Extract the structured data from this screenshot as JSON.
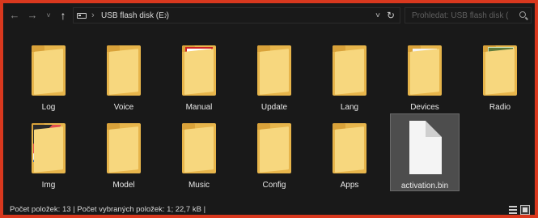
{
  "address_bar": {
    "back_icon": "arrow-left-icon",
    "forward_icon": "arrow-right-icon",
    "recent_icon": "chevron-down-icon",
    "up_icon": "arrow-up-icon",
    "path": "USB flash disk (E:)",
    "search_placeholder": "Prohledat: USB flash disk (E:)"
  },
  "items": [
    {
      "label": "Log",
      "kind": "folder",
      "doc": "blue"
    },
    {
      "label": "Voice",
      "kind": "folder",
      "doc": "blue"
    },
    {
      "label": "Manual",
      "kind": "folder",
      "doc": "red"
    },
    {
      "label": "Update",
      "kind": "folder",
      "doc": "none"
    },
    {
      "label": "Lang",
      "kind": "folder",
      "doc": "blue"
    },
    {
      "label": "Devices",
      "kind": "folder",
      "doc": "wide"
    },
    {
      "label": "Radio",
      "kind": "folder",
      "doc": "green"
    },
    {
      "label": "Img",
      "kind": "folder",
      "doc": "photo"
    },
    {
      "label": "Model",
      "kind": "folder",
      "doc": "none"
    },
    {
      "label": "Music",
      "kind": "folder",
      "doc": "none"
    },
    {
      "label": "Config",
      "kind": "folder",
      "doc": "none"
    },
    {
      "label": "Apps",
      "kind": "folder",
      "doc": "none"
    },
    {
      "label": "activation.bin",
      "kind": "file",
      "doc": "none",
      "selected": true
    }
  ],
  "status_bar": {
    "text": "Počet položek: 13 | Počet vybraných položek: 1; 22,7 kB |"
  },
  "colors": {
    "border": "#d9381e",
    "background": "#191919",
    "selection": "#4d4d4d",
    "folder": "#e7b54b"
  }
}
